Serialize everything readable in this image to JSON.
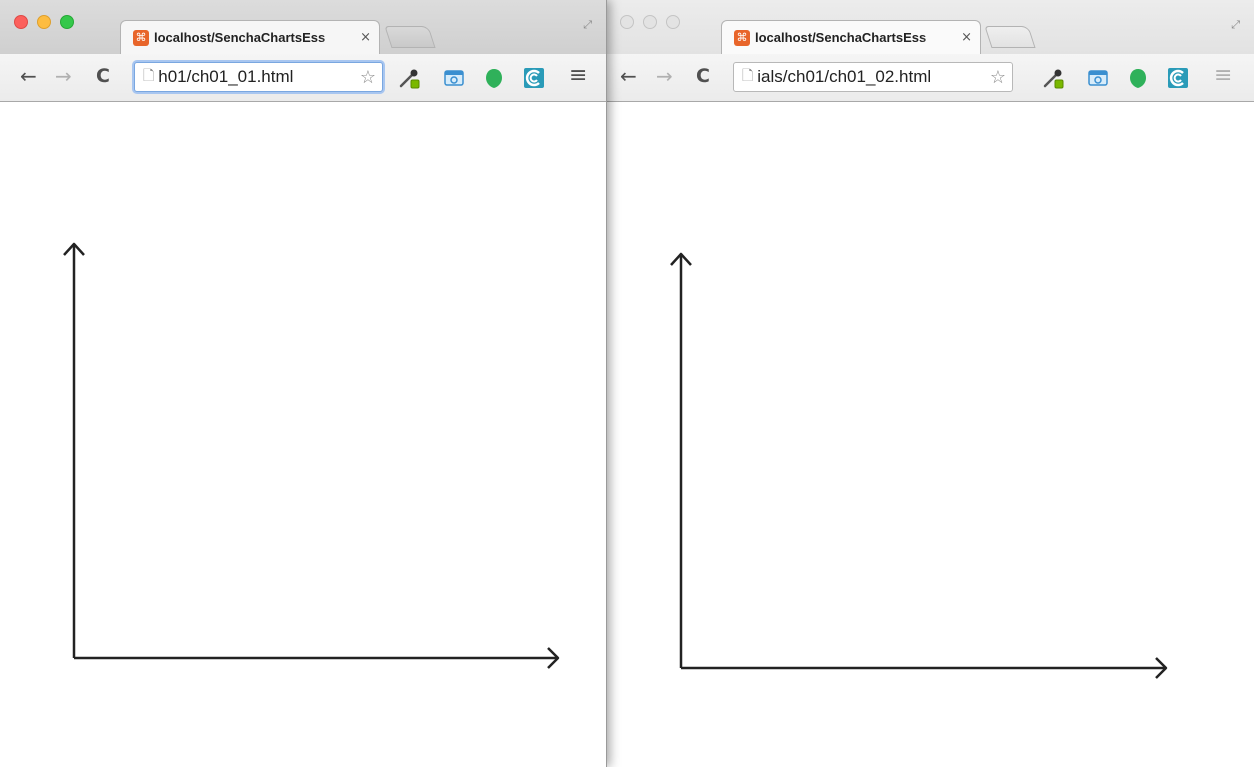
{
  "windows": [
    {
      "tab_title": "localhost/SenchaChartsEss",
      "tab_close": "×",
      "url": "h01/ch01_01.html",
      "favicon": "⌘",
      "active": true
    },
    {
      "tab_title": "localhost/SenchaChartsEss",
      "tab_close": "×",
      "url": "ials/ch01/ch01_02.html",
      "favicon": "⌘",
      "active": false
    }
  ],
  "toolbar": {
    "back": "←",
    "forward": "→",
    "reload": "C",
    "star": "☆",
    "menu": "≡",
    "page_icon": "🗋",
    "fullscreen": "⤢"
  },
  "icons": [
    "back-arrow-icon",
    "forward-arrow-icon",
    "reload-icon",
    "page-icon",
    "star-icon",
    "eyedropper-extension-icon",
    "screenshot-extension-icon",
    "evernote-extension-icon",
    "extension-c-icon",
    "menu-icon",
    "fullscreen-icon"
  ],
  "colors": {
    "favicon": "#e8652a",
    "axis": "#222222",
    "ext_green": "#2fb15a",
    "ext_teal": "#2a9bb8"
  }
}
